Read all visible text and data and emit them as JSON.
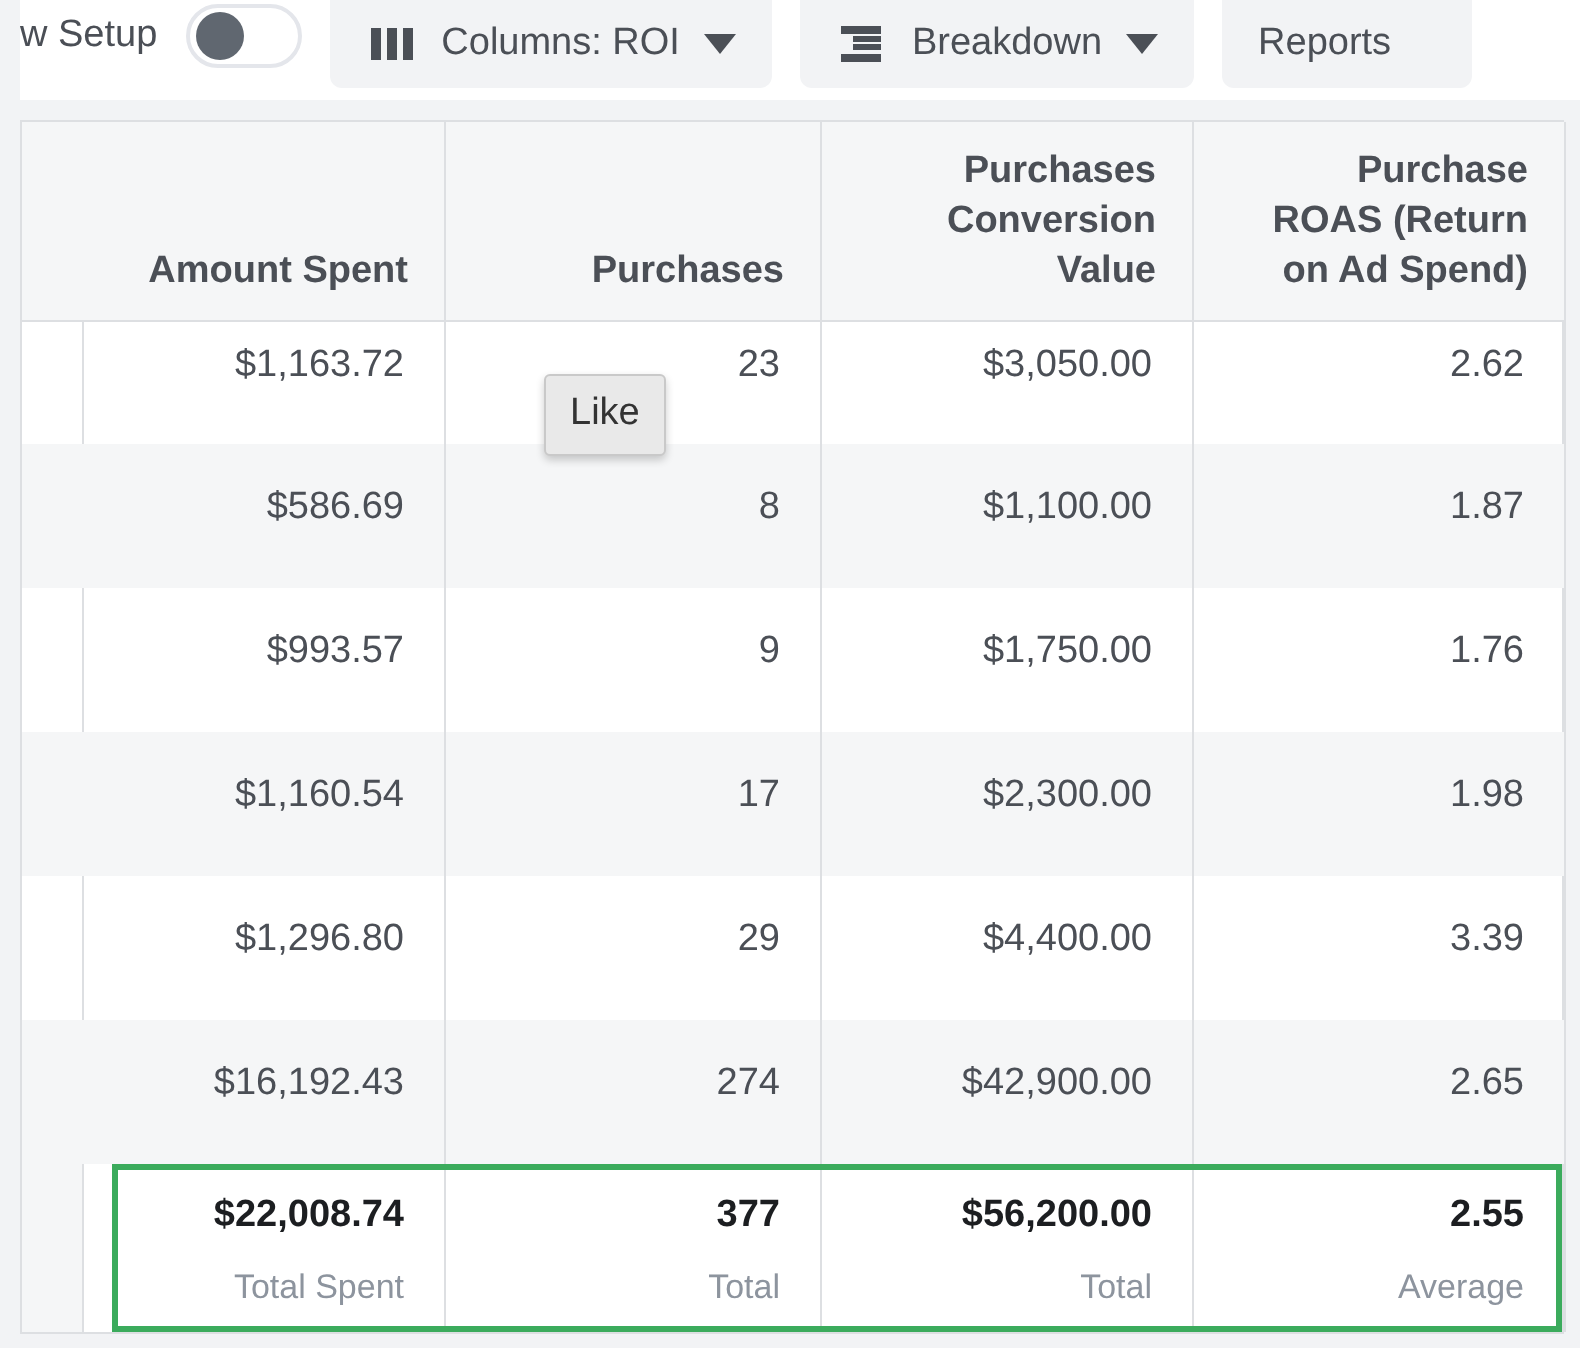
{
  "toolbar": {
    "setup_label": "w Setup",
    "setup_toggle": {
      "on": false
    },
    "buttons": [
      {
        "label": "Columns: ROI",
        "kind": "columns",
        "caret": true
      },
      {
        "label": "Breakdown",
        "kind": "breakdown",
        "caret": true
      },
      {
        "label": "Reports",
        "kind": "plain",
        "caret": false
      }
    ]
  },
  "table": {
    "columns": [
      "Amount Spent",
      "Purchases",
      "Purchases Conversion Value",
      "Purchase ROAS (Return on Ad Spend)"
    ],
    "rows": [
      {
        "cells": [
          "$1,163.72",
          "23",
          "$3,050.00",
          "2.62"
        ]
      },
      {
        "cells": [
          "$586.69",
          "8",
          "$1,100.00",
          "1.87"
        ]
      },
      {
        "cells": [
          "$993.57",
          "9",
          "$1,750.00",
          "1.76"
        ]
      },
      {
        "cells": [
          "$1,160.54",
          "17",
          "$2,300.00",
          "1.98"
        ]
      },
      {
        "cells": [
          "$1,296.80",
          "29",
          "$4,400.00",
          "3.39"
        ]
      },
      {
        "cells": [
          "$16,192.43",
          "274",
          "$42,900.00",
          "2.65"
        ]
      }
    ],
    "totals_highlighted": true,
    "totals": [
      {
        "value": "$22,008.74",
        "label": "Total Spent"
      },
      {
        "value": "377",
        "label": "Total"
      },
      {
        "value": "$56,200.00",
        "label": "Total"
      },
      {
        "value": "2.55",
        "label": "Average"
      }
    ]
  },
  "tooltip": {
    "text": "Like"
  }
}
